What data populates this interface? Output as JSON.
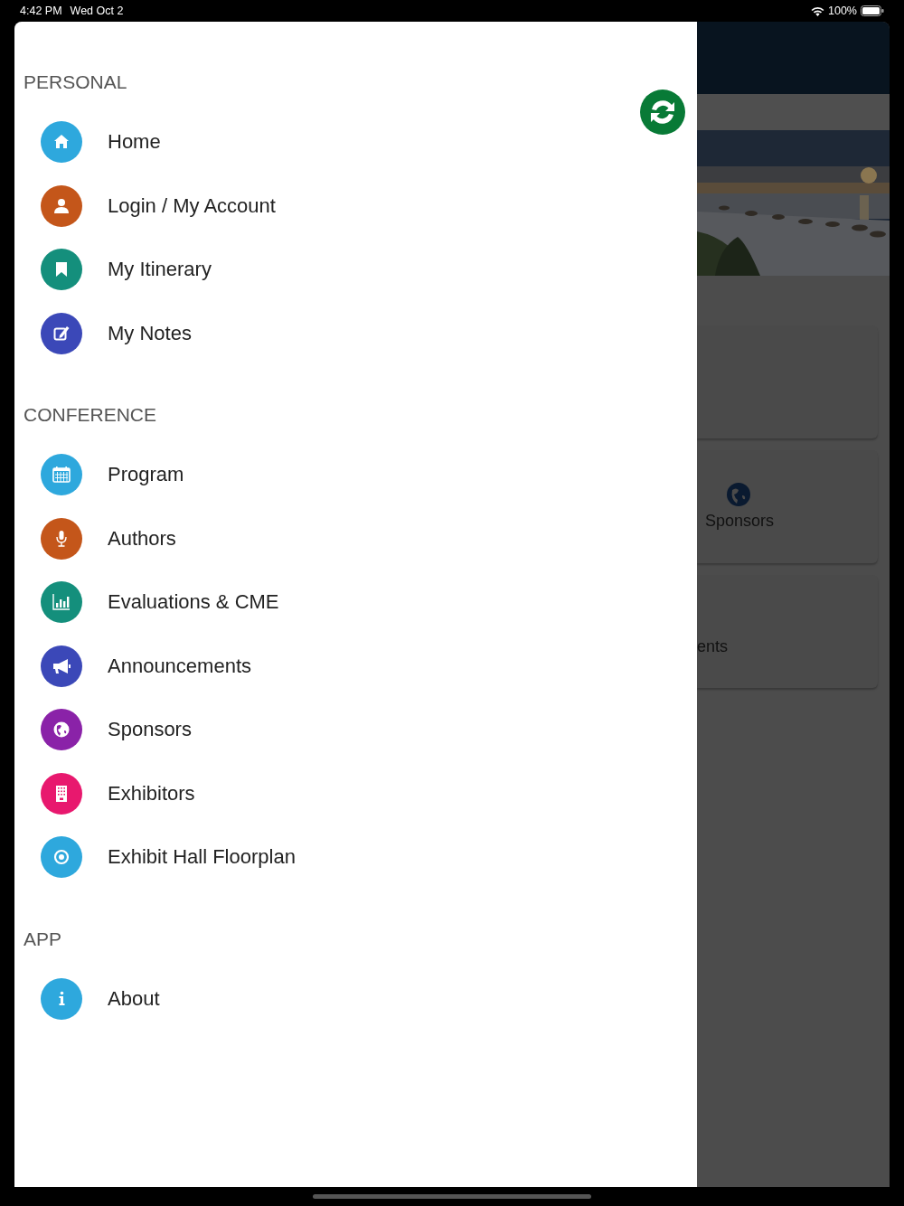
{
  "status_bar": {
    "time": "4:42 PM",
    "date": "Wed Oct 2",
    "battery": "100%"
  },
  "drawer": {
    "sections": [
      {
        "title": "PERSONAL",
        "items": [
          {
            "label": "Home",
            "kind": "home",
            "color": "#2ea8dd"
          },
          {
            "label": "Login / My Account",
            "kind": "user",
            "color": "#c4561a"
          },
          {
            "label": "My Itinerary",
            "kind": "bookmark",
            "color": "#148f7c"
          },
          {
            "label": "My Notes",
            "kind": "edit",
            "color": "#3b48b8"
          }
        ]
      },
      {
        "title": "CONFERENCE",
        "items": [
          {
            "label": "Program",
            "kind": "calendar",
            "color": "#2ea8dd"
          },
          {
            "label": "Authors",
            "kind": "mic",
            "color": "#c4561a"
          },
          {
            "label": "Evaluations & CME",
            "kind": "chart",
            "color": "#148f7c"
          },
          {
            "label": "Announcements",
            "kind": "megaphone",
            "color": "#3b48b8"
          },
          {
            "label": "Sponsors",
            "kind": "globe",
            "color": "#8a22a8"
          },
          {
            "label": "Exhibitors",
            "kind": "building",
            "color": "#e8186e"
          },
          {
            "label": "Exhibit Hall Floorplan",
            "kind": "target",
            "color": "#2ea8dd"
          }
        ]
      },
      {
        "title": "APP",
        "items": [
          {
            "label": "About",
            "kind": "info",
            "color": "#2ea8dd"
          }
        ]
      }
    ]
  },
  "background": {
    "cards": [
      {
        "kind": "blank"
      },
      {
        "kind": "icon",
        "label": "Sponsors"
      },
      {
        "kind": "text",
        "label": "ents"
      }
    ]
  }
}
